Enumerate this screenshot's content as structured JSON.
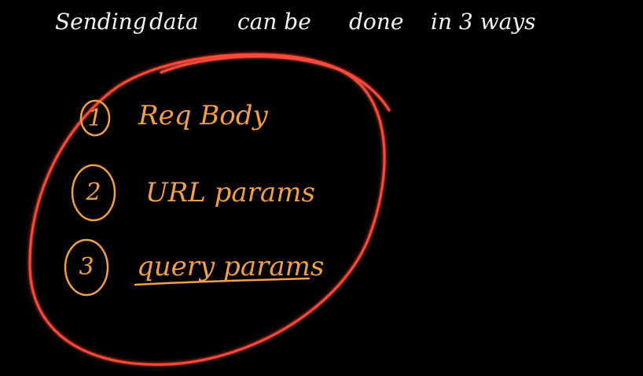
{
  "board": {
    "title_words": [
      "Sending",
      "data",
      "can be",
      "done",
      "in 3 ways"
    ],
    "items": [
      {
        "number": "1",
        "label": "Req Body"
      },
      {
        "number": "2",
        "label": "URL params"
      },
      {
        "number": "3",
        "label": "query params"
      }
    ]
  },
  "colors": {
    "background": "#000000",
    "title_ink": "#f2f2f2",
    "item_ink": "#f0a04a",
    "circle_ink": "#ff4a3a"
  }
}
